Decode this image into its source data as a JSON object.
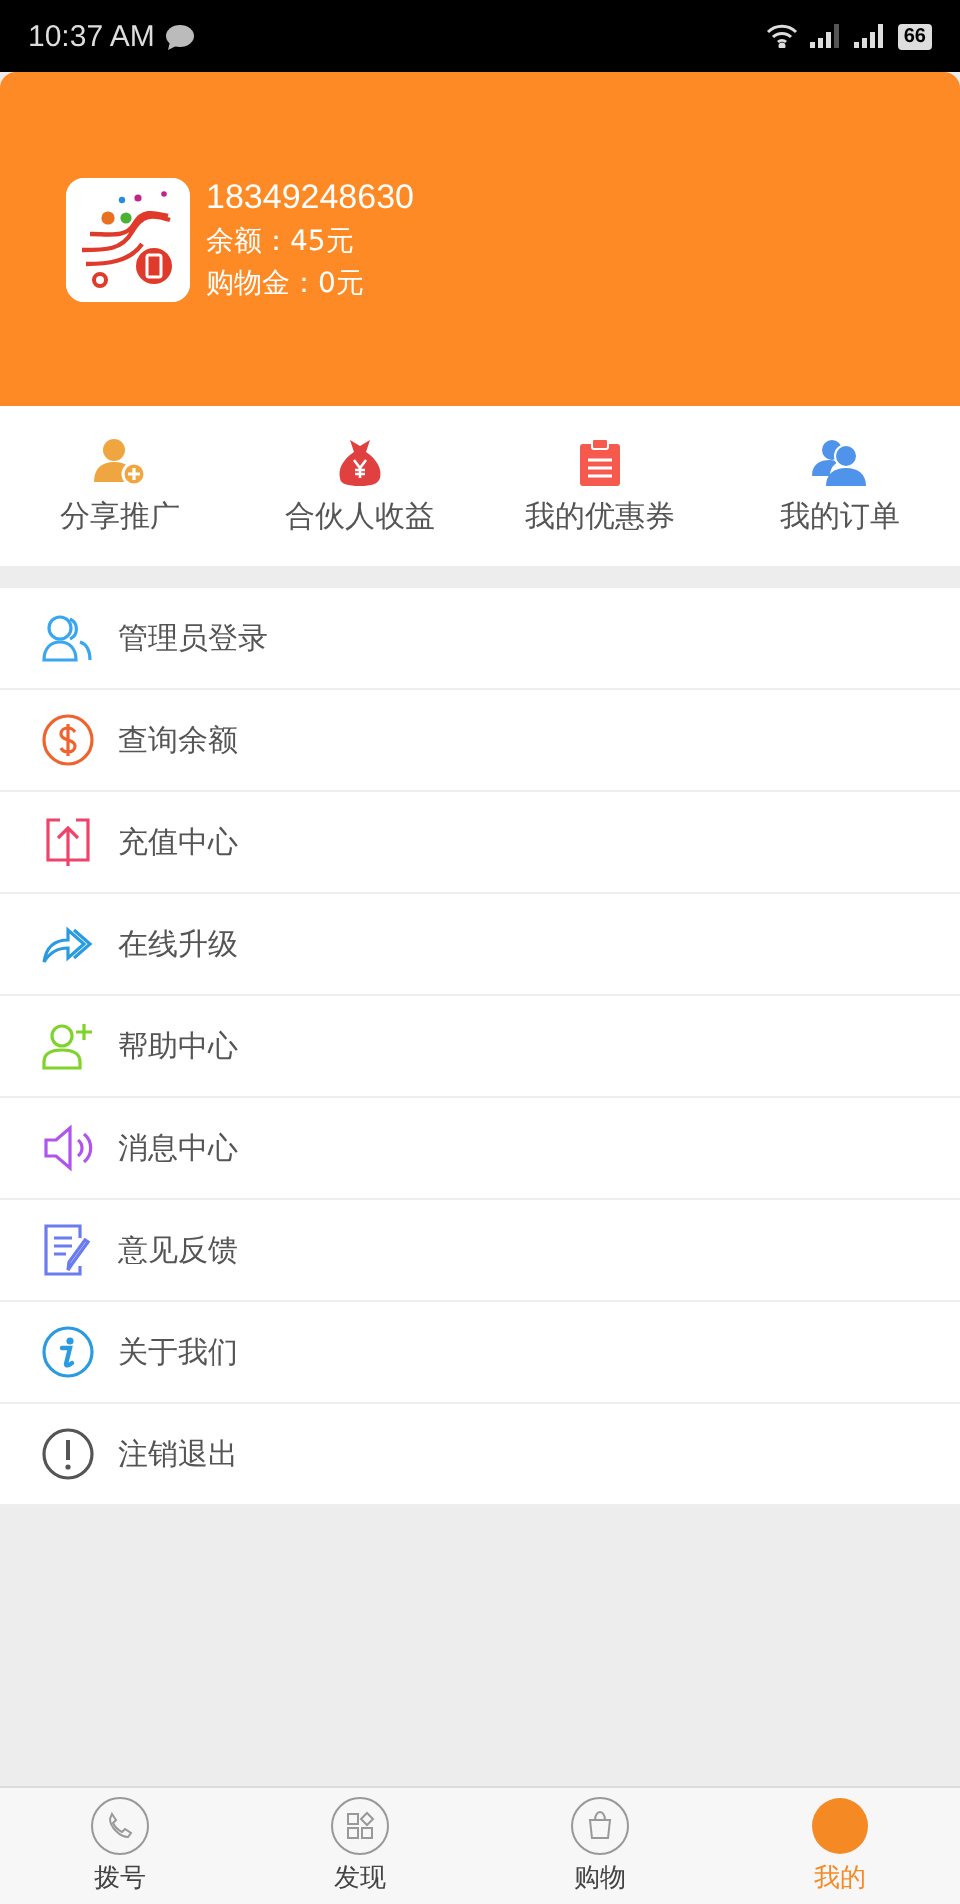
{
  "status_bar": {
    "time": "10:37 AM",
    "battery": "66"
  },
  "profile": {
    "phone": "18349248630",
    "balance_label": "余额：",
    "balance": "45元",
    "credit_label": "购物金：",
    "credit": "0元"
  },
  "shortcuts": [
    {
      "label": "分享推广"
    },
    {
      "label": "合伙人收益"
    },
    {
      "label": "我的优惠券"
    },
    {
      "label": "我的订单"
    }
  ],
  "menu": [
    {
      "label": "管理员登录"
    },
    {
      "label": "查询余额"
    },
    {
      "label": "充值中心"
    },
    {
      "label": "在线升级"
    },
    {
      "label": "帮助中心"
    },
    {
      "label": "消息中心"
    },
    {
      "label": "意见反馈"
    },
    {
      "label": "关于我们"
    },
    {
      "label": "注销退出"
    }
  ],
  "bottom_nav": [
    {
      "label": "拨号",
      "selected": false
    },
    {
      "label": "发现",
      "selected": false
    },
    {
      "label": "购物",
      "selected": false
    },
    {
      "label": "我的",
      "selected": true
    }
  ]
}
